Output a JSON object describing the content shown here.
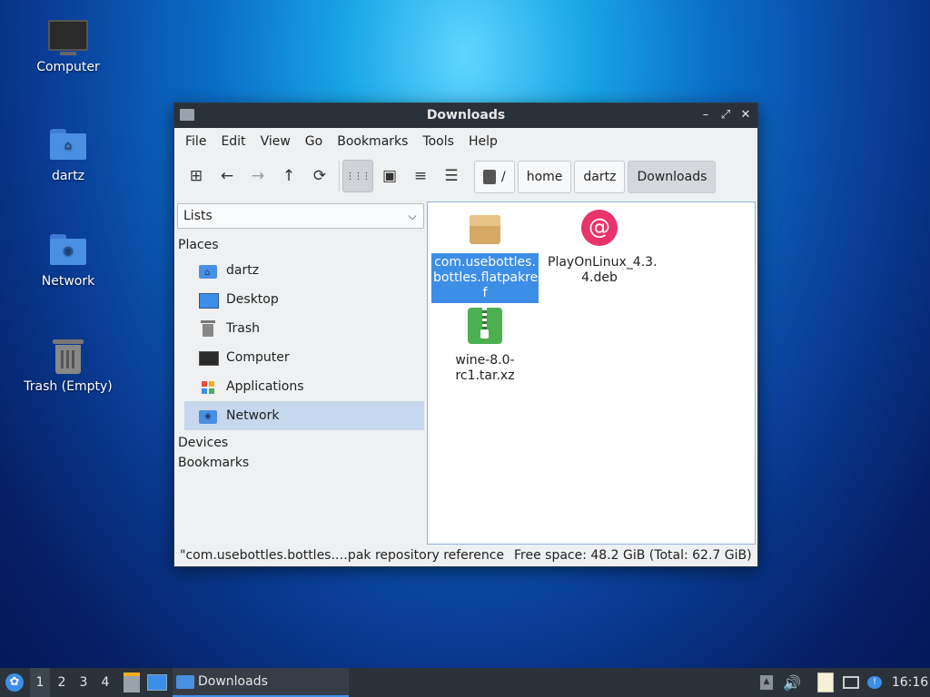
{
  "desktop": {
    "icons": [
      {
        "label": "Computer",
        "icon": "monitor-icon"
      },
      {
        "label": "dartz",
        "icon": "home-folder-icon"
      },
      {
        "label": "Network",
        "icon": "network-folder-icon"
      },
      {
        "label": "Trash (Empty)",
        "icon": "trash-icon"
      }
    ]
  },
  "window": {
    "title": "Downloads",
    "controls": {
      "minimize": "–",
      "maximize": "⤢",
      "close": "✕"
    },
    "menu": [
      "File",
      "Edit",
      "View",
      "Go",
      "Bookmarks",
      "Tools",
      "Help"
    ],
    "toolbar": {
      "new_tab": "⊞",
      "back": "←",
      "forward": "→",
      "up": "↑",
      "reload": "⟳",
      "view_icons": "⋮⋮⋮",
      "view_thumbnails": "▣",
      "view_compact": "≡",
      "view_list": "☰"
    },
    "path": {
      "root": "/",
      "crumbs": [
        "home",
        "dartz",
        "Downloads"
      ]
    },
    "sidebar": {
      "mode": "Lists",
      "places_header": "Places",
      "places": [
        "dartz",
        "Desktop",
        "Trash",
        "Computer",
        "Applications",
        "Network"
      ],
      "devices_header": "Devices",
      "bookmarks_header": "Bookmarks"
    },
    "files": [
      {
        "name": "com.usebottles.bottles.flatpakref",
        "line1": "com.usebottles.",
        "line2": "bottles.flatpakre",
        "line3": "f",
        "icon": "package-icon",
        "selected": true
      },
      {
        "name": "PlayOnLinux_4.3.4.deb",
        "line1": "PlayOnLinux_4.3.",
        "line2": "4.deb",
        "icon": "debian-icon",
        "selected": false
      },
      {
        "name": "wine-8.0-rc1.tar.xz",
        "line1": "wine-8.0-",
        "line2": "rc1.tar.xz",
        "icon": "archive-icon",
        "selected": false
      }
    ],
    "status": {
      "selection": "\"com.usebottles.bottles.…pak repository reference",
      "free_space": "Free space: 48.2 GiB (Total: 62.7 GiB)"
    }
  },
  "taskbar": {
    "workspaces": [
      "1",
      "2",
      "3",
      "4"
    ],
    "task_label": "Downloads",
    "clock": "16:16"
  }
}
